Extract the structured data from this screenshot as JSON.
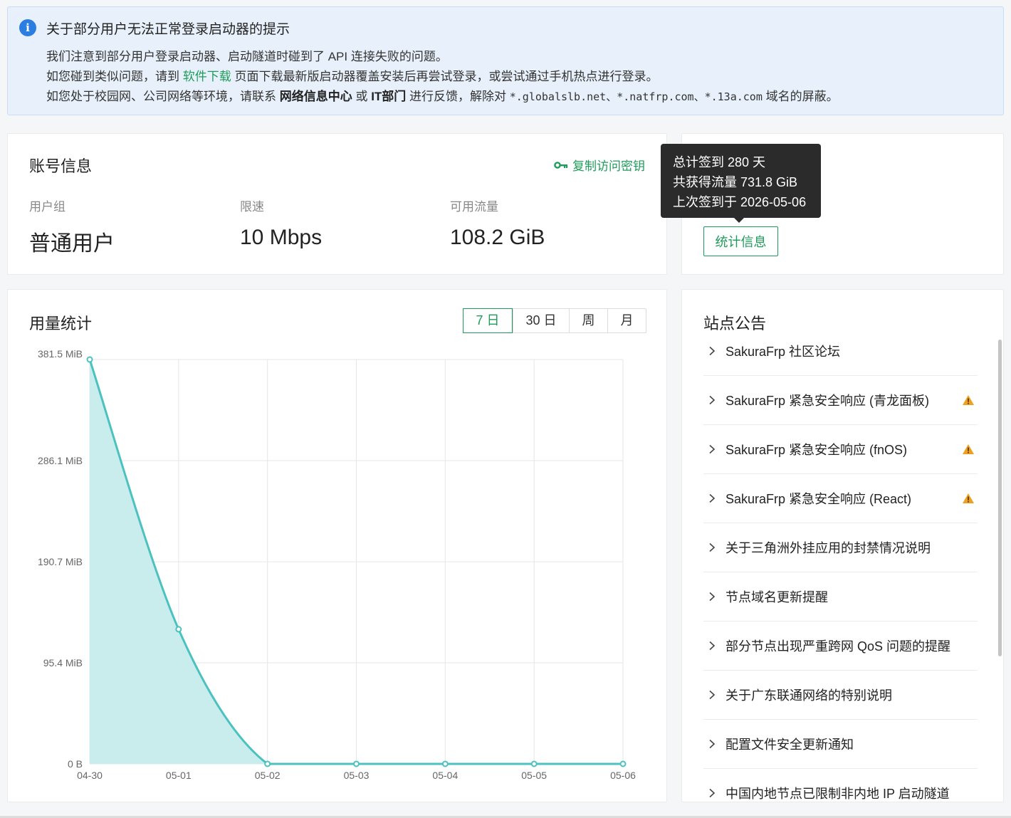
{
  "notice": {
    "title": "关于部分用户无法正常登录启动器的提示",
    "line1": "我们注意到部分用户登录启动器、启动隧道时碰到了 API 连接失败的问题。",
    "line2_pre": "如您碰到类似问题，请到 ",
    "line2_link": "软件下载",
    "line2_post": " 页面下载最新版启动器覆盖安装后再尝试登录，或尝试通过手机热点进行登录。",
    "line3_pre": "如您处于校园网、公司网络等环境，请联系 ",
    "line3_b1": "网络信息中心",
    "line3_mid": " 或 ",
    "line3_b2": "IT部门",
    "line3_mid2": " 进行反馈，解除对 ",
    "line3_domains": "*.globalslb.net、*.natfrp.com、*.13a.com",
    "line3_post": " 域名的屏蔽。"
  },
  "account": {
    "title": "账号信息",
    "copy_key_label": "复制访问密钥",
    "stats": [
      {
        "label": "用户组",
        "value": "普通用户"
      },
      {
        "label": "限速",
        "value": "10 Mbps"
      },
      {
        "label": "可用流量",
        "value": "108.2 GiB"
      }
    ]
  },
  "signin": {
    "stats_button": "统计信息",
    "tooltip": {
      "line1": "总计签到 280 天",
      "line2": "共获得流量 731.8 GiB",
      "line3": "上次签到于 2026-05-06"
    }
  },
  "usage": {
    "title": "用量统计",
    "tabs": [
      {
        "label": "7 日",
        "active": true
      },
      {
        "label": "30 日",
        "active": false
      },
      {
        "label": "周",
        "active": false
      },
      {
        "label": "月",
        "active": false
      }
    ]
  },
  "chart_data": {
    "type": "area",
    "x": [
      "04-30",
      "05-01",
      "05-02",
      "05-03",
      "05-04",
      "05-05",
      "05-06"
    ],
    "values_mib": [
      381.5,
      127.0,
      0,
      0,
      0,
      0,
      0
    ],
    "y_ticks": [
      "381.5 MiB",
      "286.1 MiB",
      "190.7 MiB",
      "95.4 MiB",
      "0 B"
    ],
    "y_tick_values": [
      381.5,
      286.1,
      190.7,
      95.4,
      0
    ],
    "ylim": [
      0,
      381.5
    ],
    "grid": true,
    "colors": {
      "line": "#4cc2c0",
      "fill": "#c9ecec",
      "grid": "#e6e6e6"
    }
  },
  "announcements": {
    "title": "站点公告",
    "items": [
      {
        "text": "SakuraFrp 社区论坛",
        "warning": false
      },
      {
        "text": "SakuraFrp 紧急安全响应 (青龙面板)",
        "warning": true
      },
      {
        "text": "SakuraFrp 紧急安全响应 (fnOS)",
        "warning": true
      },
      {
        "text": "SakuraFrp 紧急安全响应 (React)",
        "warning": true
      },
      {
        "text": "关于三角洲外挂应用的封禁情况说明",
        "warning": false
      },
      {
        "text": "节点域名更新提醒",
        "warning": false
      },
      {
        "text": "部分节点出现严重跨网 QoS 问题的提醒",
        "warning": false
      },
      {
        "text": "关于广东联通网络的特别说明",
        "warning": false
      },
      {
        "text": "配置文件安全更新通知",
        "warning": false
      },
      {
        "text": "中国内地节点已限制非内地 IP 启动隧道",
        "warning": false
      }
    ]
  },
  "theme": {
    "accent": "#1e9c5a",
    "info": "#2a7de1",
    "warning": "#f0a020"
  }
}
